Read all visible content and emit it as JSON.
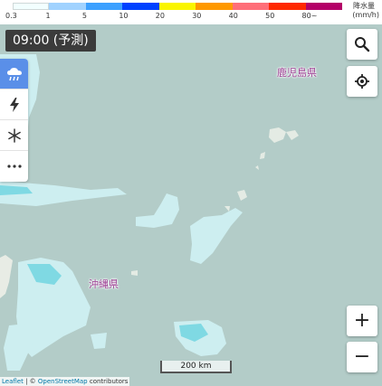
{
  "legend": {
    "unit_title": "降水量",
    "unit": "(mm/h)",
    "labels": [
      "0.3",
      "1",
      "5",
      "10",
      "20",
      "30",
      "40",
      "50",
      "80~"
    ],
    "colors": [
      "#f2ffff",
      "#a0d2ff",
      "#3ca0ff",
      "#0041ff",
      "#faf500",
      "#ff9900",
      "#ff6e78",
      "#ff2800",
      "#b40068"
    ]
  },
  "time_label": "09:00 (予測)",
  "layers": [
    {
      "name": "rain",
      "icon": "rain-cloud-icon",
      "active": true
    },
    {
      "name": "lightning",
      "icon": "lightning-icon",
      "active": false
    },
    {
      "name": "snow",
      "icon": "snowflake-icon",
      "active": false
    },
    {
      "name": "more",
      "icon": "more-icon",
      "active": false
    }
  ],
  "places": {
    "kagoshima": "鹿児島県",
    "okinawa": "沖縄県"
  },
  "controls": {
    "search_icon": "search-icon",
    "locate_icon": "locate-icon",
    "zoom_in": "+",
    "zoom_out": "−"
  },
  "scale": "200 km",
  "attribution": {
    "leaflet": "Leaflet",
    "separator": " | © ",
    "osm": "OpenStreetMap",
    "contributors": " contributors"
  },
  "colors": {
    "sea": "#b3ccc8",
    "land": "#f2efe9",
    "rain_light": "#cdeef0",
    "rain_mid": "#7fd9e3",
    "accent": "#5a8fe8",
    "place_label": "#9b3d92"
  }
}
